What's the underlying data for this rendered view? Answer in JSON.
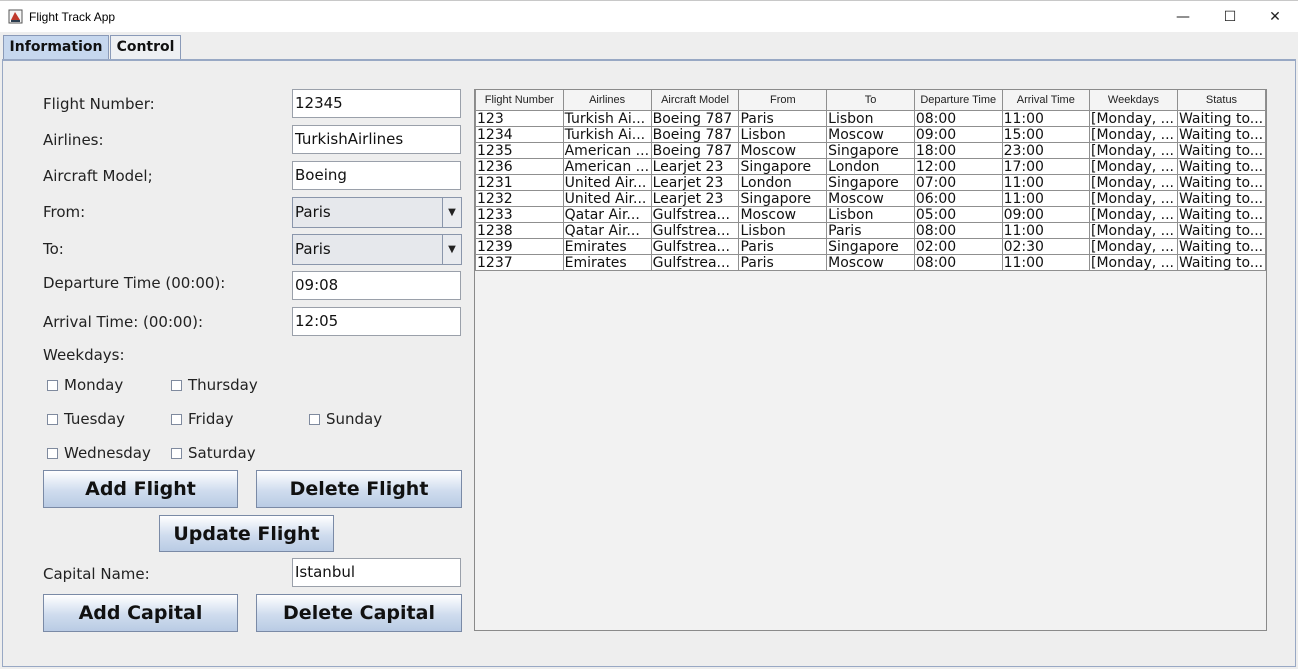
{
  "window": {
    "title": "Flight Track App",
    "minimize": "—",
    "maximize": "☐",
    "close": "✕"
  },
  "tabs": [
    {
      "label": "Information"
    },
    {
      "label": "Control"
    }
  ],
  "form": {
    "flight_number": {
      "label": "Flight Number:",
      "value": "12345"
    },
    "airlines": {
      "label": "Airlines:",
      "value": "TurkishAirlines"
    },
    "aircraft_model": {
      "label": "Aircraft Model;",
      "value": "Boeing"
    },
    "from": {
      "label": "From:",
      "value": "Paris"
    },
    "to": {
      "label": "To:",
      "value": "Paris"
    },
    "departure_time": {
      "label": "Departure Time (00:00):",
      "value": "09:08"
    },
    "arrival_time": {
      "label": "Arrival Time: (00:00):",
      "value": "12:05"
    },
    "weekdays": {
      "label": "Weekdays:",
      "days": [
        "Monday",
        "Thursday",
        "Tuesday",
        "Friday",
        "Sunday",
        "Wednesday",
        "Saturday"
      ]
    },
    "capital_name": {
      "label": "Capital Name:",
      "value": "Istanbul"
    }
  },
  "buttons": {
    "add_flight": "Add Flight",
    "delete_flight": "Delete Flight",
    "update_flight": "Update Flight",
    "add_capital": "Add Capital",
    "delete_capital": "Delete Capital"
  },
  "table": {
    "columns": [
      "Flight Number",
      "Airlines",
      "Aircraft Model",
      "From",
      "To",
      "Departure Time",
      "Arrival Time",
      "Weekdays",
      "Status"
    ],
    "rows": [
      [
        "123",
        "Turkish Ai...",
        "Boeing 787",
        "Paris",
        "Lisbon",
        "08:00",
        "11:00",
        "[Monday, ...",
        "Waiting to..."
      ],
      [
        "1234",
        "Turkish Ai...",
        "Boeing 787",
        "Lisbon",
        "Moscow",
        "09:00",
        "15:00",
        "[Monday, ...",
        "Waiting to..."
      ],
      [
        "1235",
        "American ...",
        "Boeing 787",
        "Moscow",
        "Singapore",
        "18:00",
        "23:00",
        "[Monday, ...",
        "Waiting to..."
      ],
      [
        "1236",
        "American ...",
        "Learjet 23",
        "Singapore",
        "London",
        "12:00",
        "17:00",
        "[Monday, ...",
        "Waiting to..."
      ],
      [
        "1231",
        "United Air...",
        "Learjet 23",
        "London",
        "Singapore",
        "07:00",
        "11:00",
        "[Monday, ...",
        "Waiting to..."
      ],
      [
        "1232",
        "United Air...",
        "Learjet 23",
        "Singapore",
        "Moscow",
        "06:00",
        "11:00",
        "[Monday, ...",
        "Waiting to..."
      ],
      [
        "1233",
        "Qatar Air...",
        "Gulfstrea...",
        "Moscow",
        "Lisbon",
        "05:00",
        "09:00",
        "[Monday, ...",
        "Waiting to..."
      ],
      [
        "1238",
        "Qatar Air...",
        "Gulfstrea...",
        "Lisbon",
        "Paris",
        "08:00",
        "11:00",
        "[Monday, ...",
        "Waiting to..."
      ],
      [
        "1239",
        "Emirates",
        "Gulfstrea...",
        "Paris",
        "Singapore",
        "02:00",
        "02:30",
        "[Monday, ...",
        "Waiting to..."
      ],
      [
        "1237",
        "Emirates",
        "Gulfstrea...",
        "Paris",
        "Moscow",
        "08:00",
        "11:00",
        "[Monday, ...",
        "Waiting to..."
      ]
    ]
  }
}
